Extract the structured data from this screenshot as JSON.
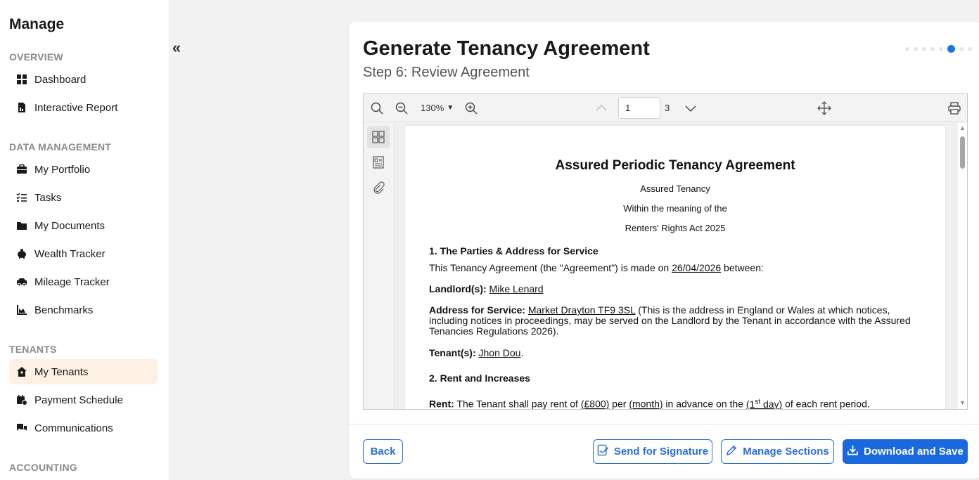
{
  "sidebar": {
    "title": "Manage",
    "sections": {
      "overview": "OVERVIEW",
      "data_management": "DATA MANAGEMENT",
      "tenants": "TENANTS",
      "accounting": "ACCOUNTING"
    },
    "items": {
      "dashboard": "Dashboard",
      "interactive_report": "Interactive Report",
      "my_portfolio": "My Portfolio",
      "tasks": "Tasks",
      "my_documents": "My Documents",
      "wealth_tracker": "Wealth Tracker",
      "mileage_tracker": "Mileage Tracker",
      "benchmarks": "Benchmarks",
      "my_tenants": "My Tenants",
      "payment_schedule": "Payment Schedule",
      "communications": "Communications"
    },
    "active_item": "My Tenants",
    "collapse_glyph": "«"
  },
  "wizard": {
    "title": "Generate Tenancy Agreement",
    "subtitle": "Step 6: Review Agreement",
    "total_steps": 8,
    "current_step": 6
  },
  "viewer": {
    "zoom": "130%",
    "current_page": "1",
    "total_pages": "3"
  },
  "document": {
    "title": "Assured Periodic Tenancy Agreement",
    "line1": "Assured Tenancy",
    "line2": "Within the meaning of the",
    "line3": "Renters' Rights Act 2025",
    "s1_heading": "1. The Parties & Address for Service",
    "s1_intro_a": "This Tenancy Agreement (the \"Agreement\") is made on ",
    "s1_date": "26/04/2026",
    "s1_intro_b": " between:",
    "landlord_label": "Landlord(s):",
    "landlord_value": "Mike Lenard",
    "address_label": "Address for Service:",
    "address_value": "Market Drayton TF9 3SL",
    "address_rest": " (This is the address in England or Wales at which notices, including notices in proceedings, may be served on the Landlord by the Tenant in accordance with the Assured Tenancies Regulations 2026).",
    "tenant_label": "Tenant(s):",
    "tenant_value": "Jhon Dou",
    "tenant_end": ".",
    "s2_heading": "2. Rent and Increases",
    "rent_label": "Rent:",
    "rent_a": " The Tenant shall pay rent of ",
    "rent_amount": "(£800)",
    "rent_b": " per ",
    "rent_period": "(month)",
    "rent_c": " in advance on the ",
    "rent_day_open": "(1",
    "rent_day_sup": "st",
    "rent_day_close": " day)",
    "rent_d": " of each rent period."
  },
  "actions": {
    "back": "Back",
    "send_signature": "Send for Signature",
    "manage_sections": "Manage Sections",
    "download_save": "Download and Save"
  },
  "colors": {
    "accent": "#1a68dd",
    "active_bg": "#fdf1e4"
  }
}
